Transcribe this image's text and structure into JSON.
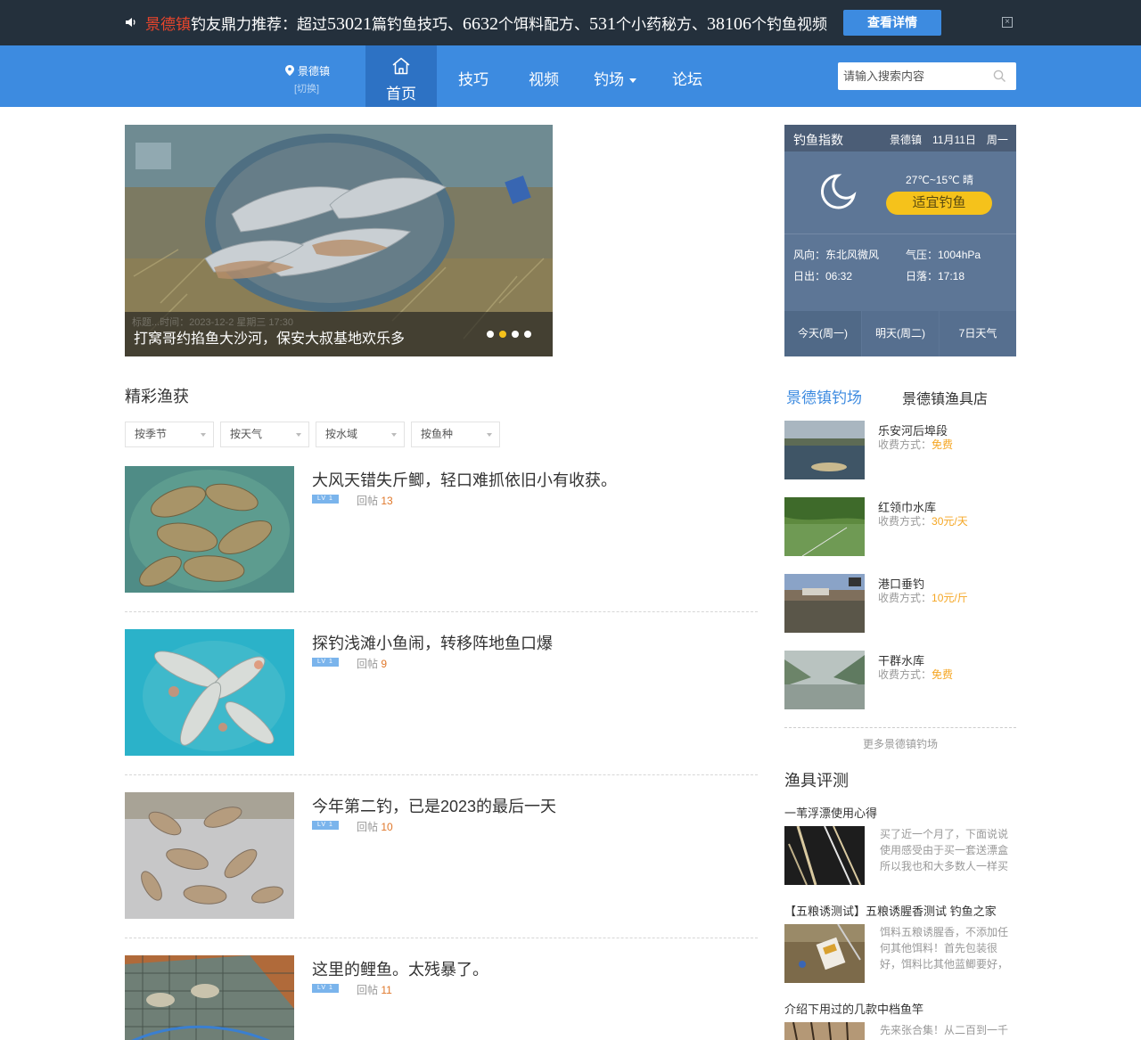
{
  "promo": {
    "city": "景德镇",
    "text_a": "钓友鼎力推荐：超过",
    "n1": "53021",
    "text_b": "篇钓鱼技巧、",
    "n2": "6632",
    "text_c": "个饵料配方、",
    "n3": "531",
    "text_d": "个小药秘方、",
    "n4": "38106",
    "text_e": "个钓鱼视频",
    "button": "查看详情",
    "close": "×"
  },
  "nav": {
    "city": "景德镇",
    "switch": "[切换]",
    "home": "首页",
    "items": [
      "技巧",
      "视频",
      "钓场",
      "论坛"
    ],
    "search_placeholder": "请输入搜索内容"
  },
  "carousel": {
    "ghost_text": "标题...时间：2023-12-2 星期三 17:30",
    "title": "打窝哥约掐鱼大沙河，保安大叔基地欢乐多",
    "active_dot": 1
  },
  "catch_section": {
    "title": "精彩渔获",
    "filters": [
      "按季节",
      "按天气",
      "按水域",
      "按鱼种"
    ],
    "reply_label": "回帖",
    "lv_label": "LV 1",
    "posts": [
      {
        "title": "大风天错失斤鲫，轻口难抓依旧小有收获。",
        "replies": "13"
      },
      {
        "title": "探钓浅滩小鱼闹，转移阵地鱼口爆",
        "replies": "9"
      },
      {
        "title": "今年第二钓，已是2023的最后一天",
        "replies": "10"
      },
      {
        "title": "这里的鲤鱼。太残暴了。",
        "replies": "11"
      }
    ]
  },
  "weather": {
    "title": "钓鱼指数",
    "date": "景德镇　11月11日　周一",
    "temp": "27℃~15℃ 晴",
    "suitability": "适宜钓鱼",
    "wind": "风向：东北风微风",
    "pressure": "气压：1004hPa",
    "sunrise": "日出：06:32",
    "sunset": "日落：17:18",
    "tabs": [
      "今天(周一)",
      "明天(周二)",
      "7日天气"
    ]
  },
  "right_tabs": {
    "spots": "景德镇钓场",
    "shop": "景德镇渔具店"
  },
  "spots": {
    "fee_label": "收费方式：",
    "items": [
      {
        "name": "乐安河后埠段",
        "fee": "免费"
      },
      {
        "name": "红领巾水库",
        "fee": "30元/天"
      },
      {
        "name": "港口垂钓",
        "fee": "10元/斤"
      },
      {
        "name": "干群水库",
        "fee": "免费"
      }
    ],
    "more": "更多景德镇钓场"
  },
  "reviews": {
    "title": "渔具评测",
    "items": [
      {
        "title": "一苇浮漂使用心得",
        "text": "买了近一个月了，下面说说使用感受由于买一套送漂盒所以我也和大多数人一样买"
      },
      {
        "title": "【五粮诱测试】五粮诱腥香测试 钓鱼之家",
        "text": "饵料五粮诱腥香，不添加任何其他饵料！首先包装很好，饵料比其他蓝鲫要好，"
      },
      {
        "title": "介绍下用过的几款中档鱼竿",
        "text": "先来张合集！从二百到一千"
      }
    ]
  },
  "colors": {
    "nav_blue": "#3d8be0",
    "nav_active": "#2d72c4",
    "promo_bg": "#24303c",
    "accent_orange": "#e0782b",
    "weather_bg": "#5d7696",
    "suit_yellow": "#f5c21b"
  }
}
